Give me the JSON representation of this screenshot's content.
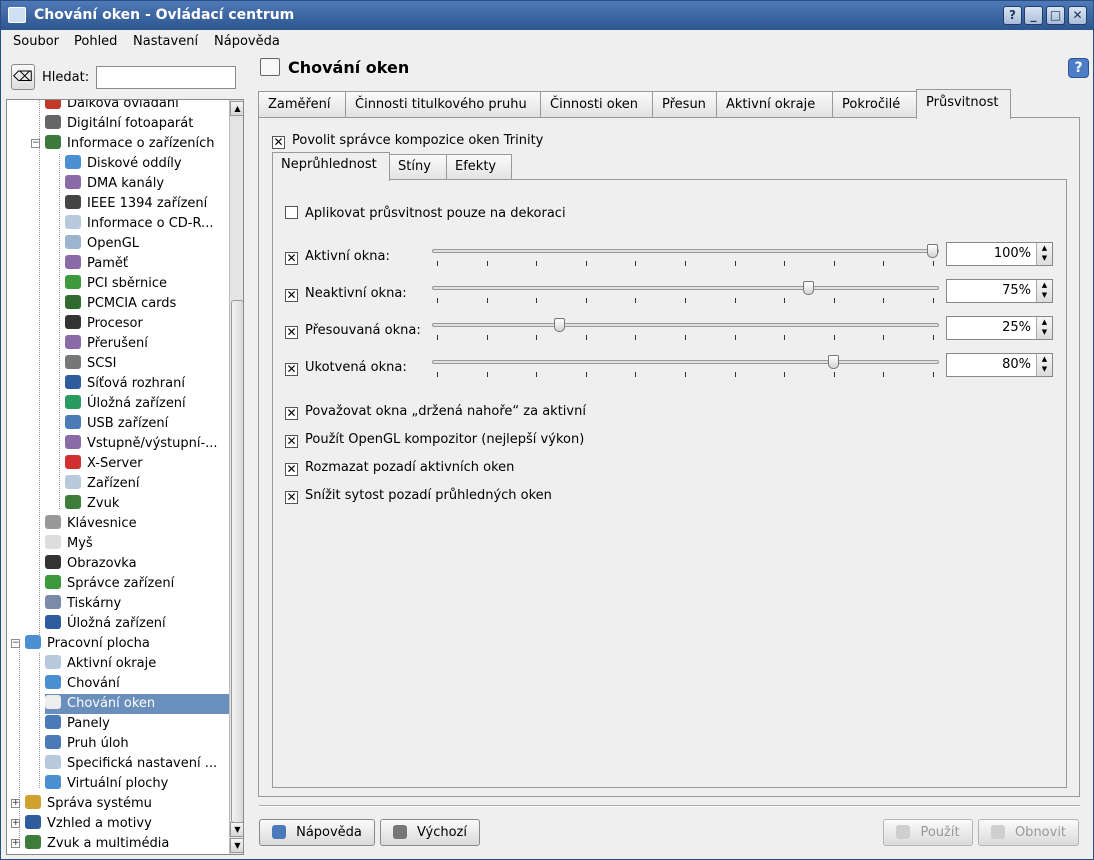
{
  "window": {
    "title": "Chování oken - Ovládací centrum"
  },
  "menu": [
    "Soubor",
    "Pohled",
    "Nastavení",
    "Nápověda"
  ],
  "search": {
    "label": "Hledat:",
    "value": ""
  },
  "tree": {
    "items": [
      {
        "label": "Dálková ovládání",
        "level": 2,
        "icon": "remote-icon",
        "color": "#c0392b"
      },
      {
        "label": "Digitální fotoaparát",
        "level": 2,
        "icon": "camera-icon",
        "color": "#666666"
      },
      {
        "label": "Informace o zařízeních",
        "level": 2,
        "icon": "info-devices-icon",
        "color": "#3b7a3b",
        "expanded": true
      },
      {
        "label": "Diskové oddíly",
        "level": 3,
        "icon": "partition-icon",
        "color": "#4a8fd0"
      },
      {
        "label": "DMA kanály",
        "level": 3,
        "icon": "dma-icon",
        "color": "#8b6aa8"
      },
      {
        "label": "IEEE 1394 zařízení",
        "level": 3,
        "icon": "firewire-icon",
        "color": "#444444"
      },
      {
        "label": "Informace o CD-R...",
        "level": 3,
        "icon": "cdrom-icon",
        "color": "#b9c9dd"
      },
      {
        "label": "OpenGL",
        "level": 3,
        "icon": "opengl-icon",
        "color": "#9cb4d0"
      },
      {
        "label": "Paměť",
        "level": 3,
        "icon": "memory-icon",
        "color": "#8b6aa8"
      },
      {
        "label": "PCI sběrnice",
        "level": 3,
        "icon": "pci-icon",
        "color": "#3c9a3c"
      },
      {
        "label": "PCMCIA cards",
        "level": 3,
        "icon": "pcmcia-icon",
        "color": "#2f6b2f"
      },
      {
        "label": "Procesor",
        "level": 3,
        "icon": "cpu-icon",
        "color": "#333333"
      },
      {
        "label": "Přerušení",
        "level": 3,
        "icon": "interrupt-icon",
        "color": "#8b6aa8"
      },
      {
        "label": "SCSI",
        "level": 3,
        "icon": "scsi-icon",
        "color": "#777777"
      },
      {
        "label": "Síťová rozhraní",
        "level": 3,
        "icon": "network-icon",
        "color": "#2d5b9e"
      },
      {
        "label": "Úložná zařízení",
        "level": 3,
        "icon": "storage-icon",
        "color": "#2a9b5e"
      },
      {
        "label": "USB zařízení",
        "level": 3,
        "icon": "usb-icon",
        "color": "#4a7ab8"
      },
      {
        "label": "Vstupně/výstupní-...",
        "level": 3,
        "icon": "io-icon",
        "color": "#8b6aa8"
      },
      {
        "label": "X-Server",
        "level": 3,
        "icon": "xserver-icon",
        "color": "#d03030"
      },
      {
        "label": "Zařízení",
        "level": 3,
        "icon": "devices-icon",
        "color": "#b9c9dd"
      },
      {
        "label": "Zvuk",
        "level": 3,
        "icon": "sound-icon",
        "color": "#3c7d3c"
      },
      {
        "label": "Klávesnice",
        "level": 2,
        "icon": "keyboard-icon",
        "color": "#999999"
      },
      {
        "label": "Myš",
        "level": 2,
        "icon": "mouse-icon",
        "color": "#dddddd"
      },
      {
        "label": "Obrazovka",
        "level": 2,
        "icon": "display-icon",
        "color": "#333333"
      },
      {
        "label": "Správce zařízení",
        "level": 2,
        "icon": "device-manager-icon",
        "color": "#3c9a3c"
      },
      {
        "label": "Tiskárny",
        "level": 2,
        "icon": "printer-icon",
        "color": "#7a8aa8"
      },
      {
        "label": "Úložná zařízení",
        "level": 2,
        "icon": "storage-devices-icon",
        "color": "#2d5b9e"
      },
      {
        "label": "Pracovní plocha",
        "level": 1,
        "icon": "desktop-icon",
        "color": "#4a8fd0",
        "expanded": true
      },
      {
        "label": "Aktivní okraje",
        "level": 2,
        "icon": "active-edges-icon",
        "color": "#b9c9dd"
      },
      {
        "label": "Chování",
        "level": 2,
        "icon": "behavior-icon",
        "color": "#4a8fd0"
      },
      {
        "label": "Chování oken",
        "level": 2,
        "icon": "window-behavior-icon",
        "color": "#eeeeee",
        "selected": true
      },
      {
        "label": "Panely",
        "level": 2,
        "icon": "panels-icon",
        "color": "#4a7ab8"
      },
      {
        "label": "Pruh úloh",
        "level": 2,
        "icon": "taskbar-icon",
        "color": "#4a7ab8"
      },
      {
        "label": "Specifická nastavení ...",
        "level": 2,
        "icon": "specific-settings-icon",
        "color": "#b9c9dd"
      },
      {
        "label": "Virtuální plochy",
        "level": 2,
        "icon": "virtual-desktops-icon",
        "color": "#4a8fd0"
      },
      {
        "label": "Správa systému",
        "level": 1,
        "icon": "system-admin-icon",
        "color": "#d0a030"
      },
      {
        "label": "Vzhled a motivy",
        "level": 1,
        "icon": "appearance-icon",
        "color": "#2d5b9e"
      },
      {
        "label": "Zvuk a multimédia",
        "level": 1,
        "icon": "multimedia-icon",
        "color": "#3c7d3c"
      }
    ]
  },
  "page": {
    "title": "Chování oken"
  },
  "tabs": [
    "Zaměření",
    "Činnosti titulkového pruhu",
    "Činnosti oken",
    "Přesun",
    "Aktivní okraje",
    "Pokročilé",
    "Průsvitnost"
  ],
  "active_tab": "Průsvitnost",
  "compositor_checkbox": {
    "label": "Povolit správce kompozice oken Trinity",
    "checked": true
  },
  "subtabs": [
    "Neprůhlednost",
    "Stíny",
    "Efekty"
  ],
  "active_subtab": "Neprůhlednost",
  "decor_only": {
    "label": "Aplikovat průsvitnost pouze na dekoraci",
    "checked": false
  },
  "sliders": [
    {
      "label": "Aktivní okna:",
      "checked": true,
      "value": 100,
      "display": "100%"
    },
    {
      "label": "Neaktivní okna:",
      "checked": true,
      "value": 75,
      "display": "75%"
    },
    {
      "label": "Přesouvaná okna:",
      "checked": true,
      "value": 25,
      "display": "25%"
    },
    {
      "label": "Ukotvená okna:",
      "checked": true,
      "value": 80,
      "display": "80%"
    }
  ],
  "options": [
    {
      "label": "Považovat okna „držená nahoře“ za aktivní",
      "checked": true
    },
    {
      "label": "Použít OpenGL kompozitor (nejlepší výkon)",
      "checked": true
    },
    {
      "label": "Rozmazat pozadí aktivních oken",
      "checked": true
    },
    {
      "label": "Snížit sytost pozadí průhledných oken",
      "checked": true
    }
  ],
  "buttons": {
    "help": "Nápověda",
    "default": "Výchozí",
    "apply": "Použít",
    "reset": "Obnovit"
  }
}
